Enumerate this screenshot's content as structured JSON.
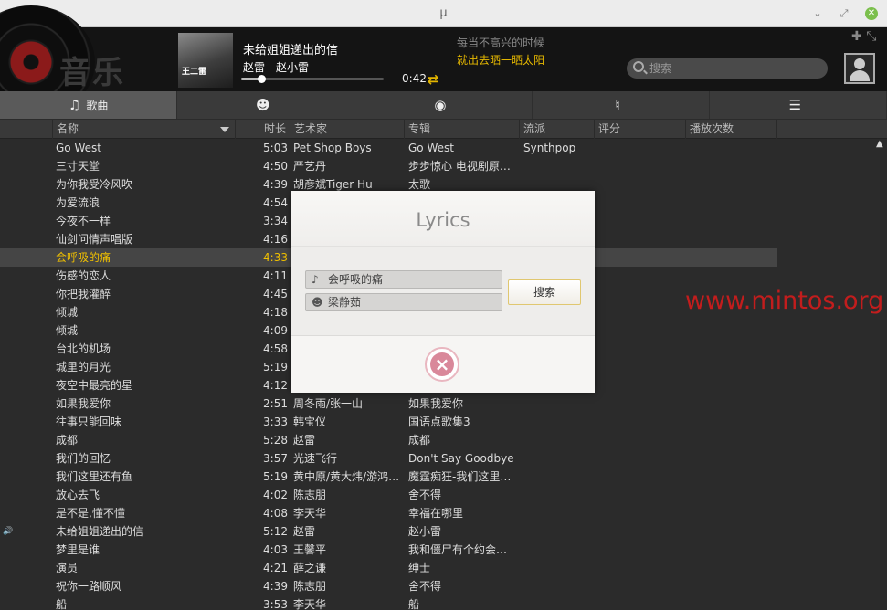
{
  "window": {
    "title": "μ"
  },
  "header": {
    "cover_text": "王二雷",
    "now_playing": {
      "title": "未给姐姐递出的信",
      "artist_album": "赵雷 - 赵小雷",
      "elapsed": "0:42",
      "progress": 0.14
    },
    "lyrics_preview": [
      "每当不高兴的时候",
      "就出去晒一晒太阳"
    ],
    "search": {
      "placeholder": "搜索"
    }
  },
  "tabs": [
    {
      "label": "歌曲",
      "icon": "music-note-icon"
    },
    {
      "label": "",
      "icon": "artist-icon"
    },
    {
      "label": "",
      "icon": "album-disc-icon"
    },
    {
      "label": "",
      "icon": "guitar-icon"
    },
    {
      "label": "",
      "icon": "playlist-icon"
    }
  ],
  "columns": [
    "名称",
    "时长",
    "艺术家",
    "专辑",
    "流派",
    "评分",
    "播放次数"
  ],
  "rows": [
    {
      "title": "Go West",
      "duration": "5:03",
      "artist": "Pet Shop Boys",
      "album": "Go West",
      "genre": "Synthpop"
    },
    {
      "title": "三寸天堂",
      "duration": "4:50",
      "artist": "严艺丹",
      "album": "步步惊心 电视剧原…",
      "genre": ""
    },
    {
      "title": "为你我受冷风吹",
      "duration": "4:39",
      "artist": "胡彦斌Tiger Hu",
      "album": "太歌",
      "genre": ""
    },
    {
      "title": "为爱流浪",
      "duration": "4:54",
      "artist": "",
      "album": "",
      "genre": ""
    },
    {
      "title": "今夜不一样",
      "duration": "3:34",
      "artist": "",
      "album": "",
      "genre": ""
    },
    {
      "title": "仙剑问情声唱版",
      "duration": "4:16",
      "artist": "",
      "album": "",
      "genre": ""
    },
    {
      "title": "会呼吸的痛",
      "duration": "4:33",
      "artist": "",
      "album": "",
      "genre": ""
    },
    {
      "title": "伤感的恋人",
      "duration": "4:11",
      "artist": "",
      "album": "",
      "genre": ""
    },
    {
      "title": "你把我灌醉",
      "duration": "4:45",
      "artist": "",
      "album": "",
      "genre": ""
    },
    {
      "title": "倾城",
      "duration": "4:18",
      "artist": "",
      "album": "",
      "genre": ""
    },
    {
      "title": "倾城",
      "duration": "4:09",
      "artist": "",
      "album": "",
      "genre": ""
    },
    {
      "title": "台北的机场",
      "duration": "4:58",
      "artist": "",
      "album": "",
      "genre": ""
    },
    {
      "title": "城里的月光",
      "duration": "5:19",
      "artist": "",
      "album": "",
      "genre": ""
    },
    {
      "title": "夜空中最亮的星",
      "duration": "4:12",
      "artist": "",
      "album": "",
      "genre": ""
    },
    {
      "title": "如果我爱你",
      "duration": "2:51",
      "artist": "周冬雨/张一山",
      "album": "如果我爱你",
      "genre": ""
    },
    {
      "title": "往事只能回味",
      "duration": "3:33",
      "artist": "韩宝仪",
      "album": "国语点歌集3",
      "genre": ""
    },
    {
      "title": "成都",
      "duration": "5:28",
      "artist": "赵雷",
      "album": "成都",
      "genre": ""
    },
    {
      "title": "我们的回忆",
      "duration": "3:57",
      "artist": "光速飞行",
      "album": "Don't Say Goodbye",
      "genre": ""
    },
    {
      "title": "我们这里还有鱼",
      "duration": "5:19",
      "artist": "黄中原/黄大炜/游鸿…",
      "album": "魔霆痴狂-我们这里…",
      "genre": ""
    },
    {
      "title": "放心去飞",
      "duration": "4:02",
      "artist": "陈志朋",
      "album": "舍不得",
      "genre": ""
    },
    {
      "title": "是不是,懂不懂",
      "duration": "4:08",
      "artist": "李天华",
      "album": "幸福在哪里",
      "genre": ""
    },
    {
      "title": "未给姐姐递出的信",
      "duration": "5:12",
      "artist": "赵雷",
      "album": "赵小雷",
      "genre": ""
    },
    {
      "title": "梦里是谁",
      "duration": "4:03",
      "artist": "王馨平",
      "album": "我和僵尸有个约会…",
      "genre": ""
    },
    {
      "title": "演员",
      "duration": "4:21",
      "artist": "薛之谦",
      "album": "绅士",
      "genre": ""
    },
    {
      "title": "祝你一路顺风",
      "duration": "4:39",
      "artist": "陈志朋",
      "album": "舍不得",
      "genre": ""
    },
    {
      "title": "船",
      "duration": "3:53",
      "artist": "李天华",
      "album": "船",
      "genre": ""
    }
  ],
  "selected_row": 6,
  "playing_row": 21,
  "dialog": {
    "title": "Lyrics",
    "song_value": "会呼吸的痛",
    "artist_value": "梁静茹",
    "search_label": "搜索"
  },
  "watermark": "www.mintos.org",
  "colors": {
    "accent": "#f0c000",
    "watermark": "#c21d1d"
  }
}
